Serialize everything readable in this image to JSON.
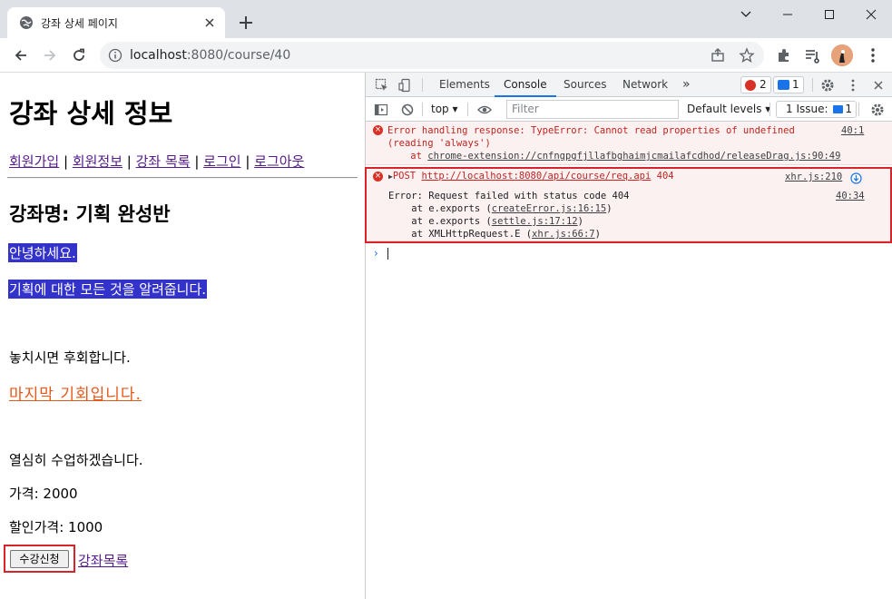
{
  "browser": {
    "tab_title": "강좌 상세 페이지",
    "new_tab_label": "+",
    "url_host": "localhost",
    "url_rest": ":8080/course/40"
  },
  "page": {
    "title": "강좌 상세 정보",
    "nav": [
      {
        "label": "회원가입"
      },
      {
        "label": "회원정보"
      },
      {
        "label": "강좌 목록"
      },
      {
        "label": "로그인"
      },
      {
        "label": "로그아웃"
      }
    ],
    "nav_separator": " | ",
    "course_name": "강좌명: 기획 완성반",
    "highlight_line_1": "안녕하세요.",
    "highlight_line_2": "기획에 대한 모든 것을 알려줍니다.",
    "line_miss": "놓치시면 후회합니다.",
    "last_chance": "마지막 기회입니다.",
    "line_study": "열심히 수업하겠습니다.",
    "price": "가격: 2000",
    "sale_price": "할인가격: 1000",
    "enroll_button": "수강신청",
    "course_list_link": "강좌목록"
  },
  "devtools": {
    "tabs": [
      "Elements",
      "Console",
      "Sources",
      "Network"
    ],
    "active_tab": "Console",
    "more_tabs": "»",
    "error_count": "2",
    "message_count": "1",
    "context": "top",
    "filter_placeholder": "Filter",
    "levels": "Default levels",
    "issues": "1 Issue:",
    "issues_count": "1",
    "messages": {
      "m1_line1": "Error handling response: TypeError: Cannot read properties of undefined",
      "m1_line2": "(reading 'always')",
      "m1_at": "    at ",
      "m1_link": "chrome-extension://cnfngpgfjllafbghaimjcmailafcdhod/releaseDrag.js:90:49",
      "m1_source": "40:1",
      "m2_method": "POST ",
      "m2_url": "http://localhost:8080/api/course/req.api",
      "m2_status": " 404",
      "m2_source": "xhr.js:210",
      "m3_line": "Error: Request failed with status code 404",
      "m3_source": "40:34",
      "trace": [
        {
          "prefix": "    at e.exports (",
          "link": "createError.js:16:15",
          "suffix": ")"
        },
        {
          "prefix": "    at e.exports (",
          "link": "settle.js:17:12",
          "suffix": ")"
        },
        {
          "prefix": "    at XMLHttpRequest.E (",
          "link": "xhr.js:66:7",
          "suffix": ")"
        }
      ]
    },
    "prompt": "›"
  },
  "colors": {
    "highlight_bg": "#3333cc",
    "orange_text": "#e4581b",
    "error_red": "#c5221f",
    "annotation_red": "#d8232a",
    "devtools_accent": "#1a73e8"
  },
  "icons": [
    "globe-icon",
    "close-icon",
    "plus-icon",
    "minimize-icon",
    "maximize-icon",
    "chevron-down-icon",
    "back-icon",
    "forward-icon",
    "reload-icon",
    "info-icon",
    "share-icon",
    "star-icon",
    "extensions-icon",
    "reading-list-icon",
    "menu-icon",
    "inspect-icon",
    "device-icon",
    "sidebar-icon",
    "clear-icon",
    "eye-icon",
    "settings-icon",
    "error-icon",
    "link-icon"
  ]
}
